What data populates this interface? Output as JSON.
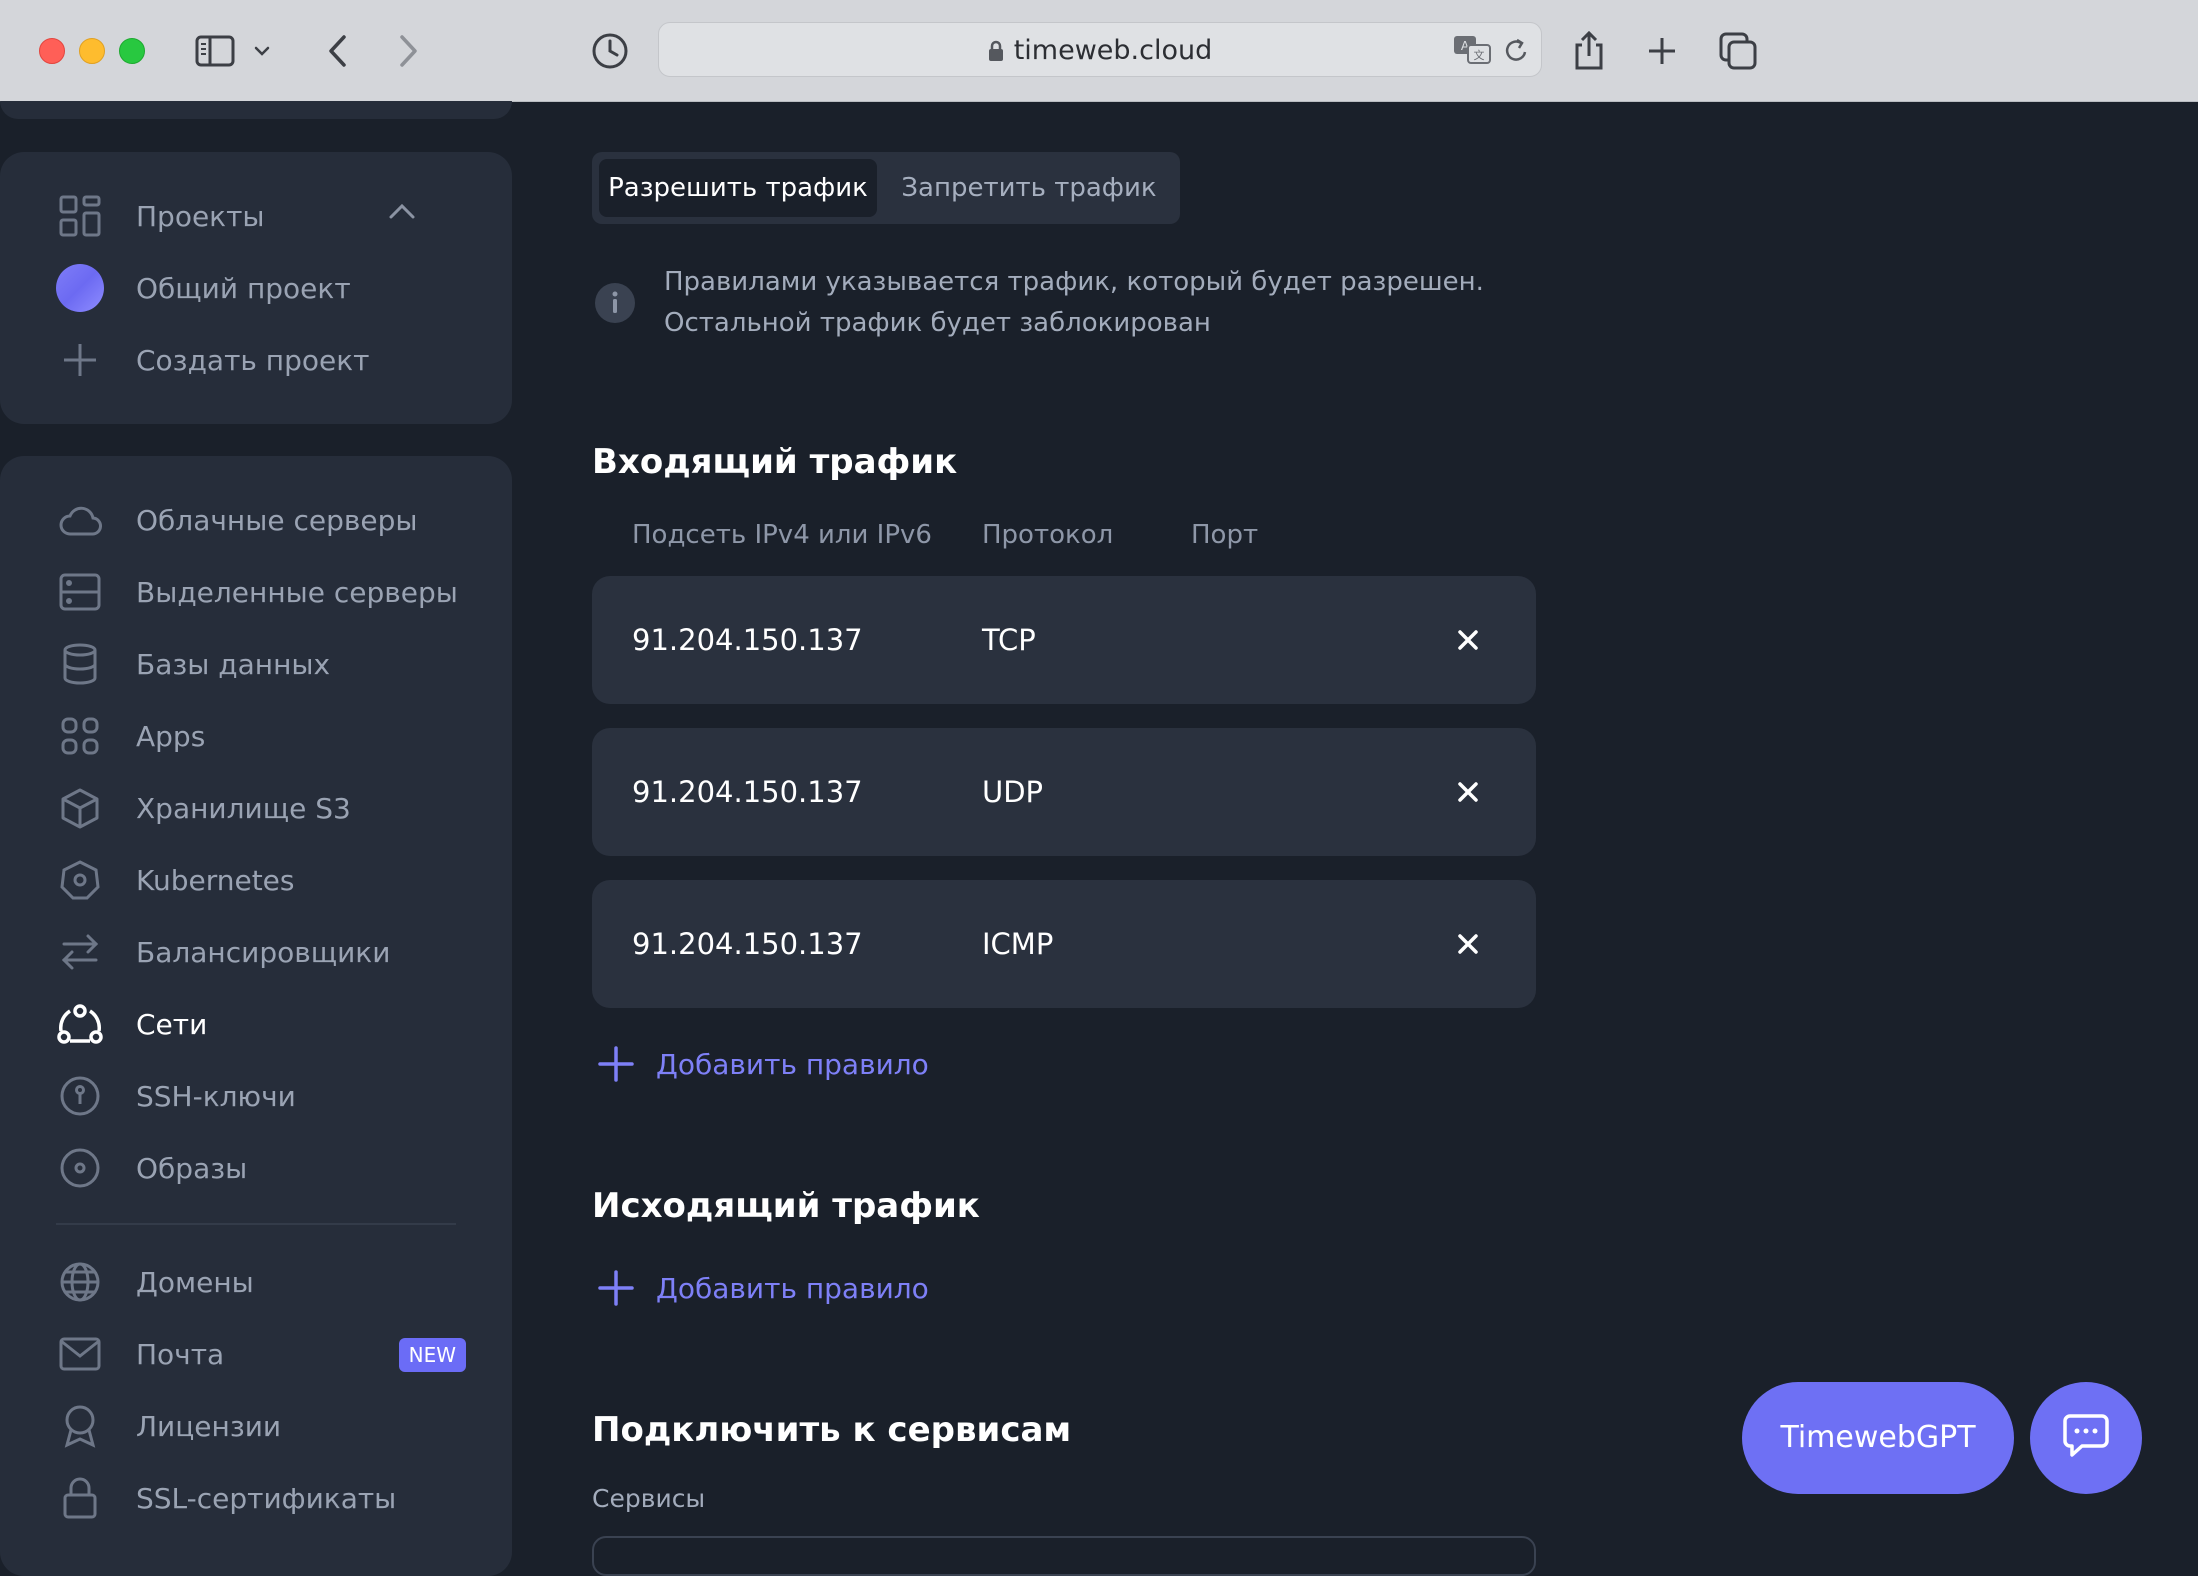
{
  "browser": {
    "url": "timeweb.cloud",
    "icons": [
      "sidebar-icon",
      "chevron-down-icon",
      "back-icon",
      "forward-icon",
      "history-icon",
      "lock-icon",
      "translate-icon",
      "reload-icon",
      "share-icon",
      "new-tab-icon",
      "tabs-overview-icon"
    ]
  },
  "sidebar": {
    "projects_header": "Проекты",
    "projects": [
      {
        "label": "Общий проект",
        "icon": "avatar"
      },
      {
        "label": "Создать проект",
        "icon": "plus-icon"
      }
    ],
    "items": [
      {
        "label": "Облачные серверы",
        "icon": "cloud-icon"
      },
      {
        "label": "Выделенные серверы",
        "icon": "server-icon"
      },
      {
        "label": "Базы данных",
        "icon": "database-icon"
      },
      {
        "label": "Apps",
        "icon": "apps-icon"
      },
      {
        "label": "Хранилище S3",
        "icon": "cube-icon"
      },
      {
        "label": "Kubernetes",
        "icon": "kubernetes-icon"
      },
      {
        "label": "Балансировщики",
        "icon": "arrows-icon"
      },
      {
        "label": "Сети",
        "icon": "network-icon",
        "active": true
      },
      {
        "label": "SSH-ключи",
        "icon": "key-icon"
      },
      {
        "label": "Образы",
        "icon": "disc-icon"
      }
    ],
    "items2": [
      {
        "label": "Домены",
        "icon": "globe-icon"
      },
      {
        "label": "Почта",
        "icon": "mail-icon",
        "badge": "NEW"
      },
      {
        "label": "Лицензии",
        "icon": "award-icon"
      },
      {
        "label": "SSL-сертификаты",
        "icon": "lock-icon"
      }
    ]
  },
  "main": {
    "tabs": [
      "Разрешить трафик",
      "Запретить трафик"
    ],
    "info_lines": [
      "Правилами указывается трафик, который будет разрешен.",
      "Остальной трафик будет заблокирован"
    ],
    "incoming_title": "Входящий трафик",
    "columns": [
      "Подсеть IPv4 или IPv6",
      "Протокол",
      "Порт"
    ],
    "incoming_rules": [
      {
        "subnet": "91.204.150.137",
        "protocol": "TCP"
      },
      {
        "subnet": "91.204.150.137",
        "protocol": "UDP"
      },
      {
        "subnet": "91.204.150.137",
        "protocol": "ICMP"
      }
    ],
    "add_rule": "Добавить правило",
    "outgoing_title": "Исходящий трафик",
    "connect_title": "Подключить к сервисам",
    "services_label": "Сервисы"
  },
  "floating": {
    "gpt_label": "TimewebGPT"
  },
  "colors": {
    "background": "#1a202a",
    "panel": "#2a313e",
    "accent": "#6e70f4",
    "link": "#7e80f7"
  }
}
